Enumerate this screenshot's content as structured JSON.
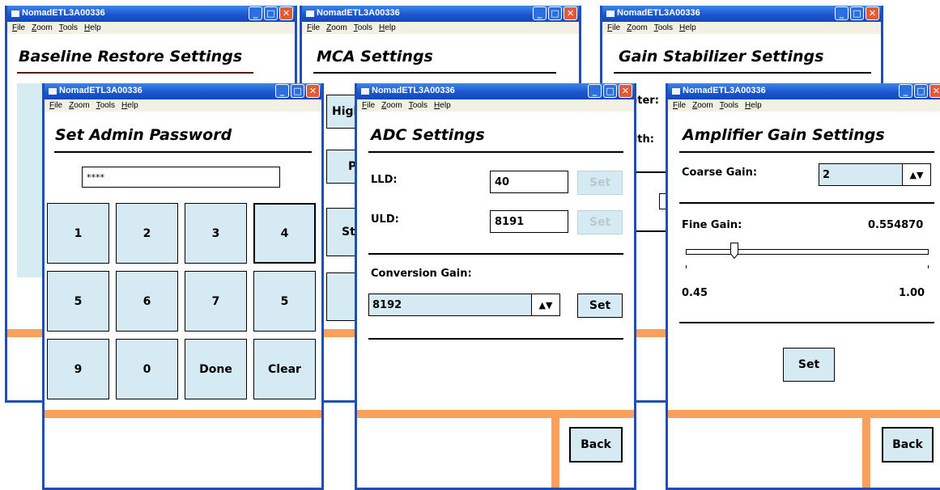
{
  "window_title": "NomadETL3A00336",
  "menu": [
    "File",
    "Zoom",
    "Tools",
    "Help"
  ],
  "titlebar_buttons": {
    "minimize": "_",
    "maximize": "□",
    "close": "✕"
  },
  "baseline": {
    "title": "Baseline Restore Settings"
  },
  "mca": {
    "title": "MCA Settings",
    "clipped_labels": [
      "Higl",
      "P",
      "St",
      "A"
    ]
  },
  "gainstab": {
    "title": "Gain Stabilizer Settings",
    "clipped_labels": [
      "nter:",
      "dth:"
    ]
  },
  "admin": {
    "title": "Set Admin Password",
    "password_value": "****",
    "keys": [
      "1",
      "2",
      "3",
      "4",
      "5",
      "6",
      "7",
      "5",
      "9",
      "0",
      "Done",
      "Clear"
    ]
  },
  "adc": {
    "title": "ADC Settings",
    "lld_label": "LLD:",
    "lld_value": "40",
    "uld_label": "ULD:",
    "uld_value": "8191",
    "set_label": "Set",
    "conversion_label": "Conversion Gain:",
    "conversion_value": "8192",
    "back_label": "Back"
  },
  "amp": {
    "title": "Amplifier Gain Settings",
    "coarse_label": "Coarse Gain:",
    "coarse_value": "2",
    "fine_label": "Fine Gain:",
    "fine_value": "0.554870",
    "fine_fraction": 0.19,
    "min_label": "0.45",
    "max_label": "1.00",
    "set_label": "Set",
    "back_label": "Back"
  },
  "colors": {
    "titlebar": "#1c57cf",
    "button_fill": "#d5eaf2",
    "accent_orange": "#f8a05c",
    "menubar": "#f2efe4"
  }
}
